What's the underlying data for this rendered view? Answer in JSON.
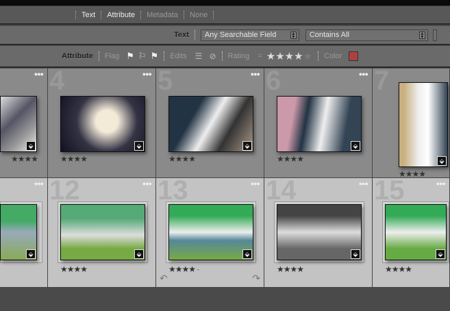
{
  "tabs": [
    "Text",
    "Attribute",
    "Metadata",
    "None"
  ],
  "text_filter": {
    "label": "Text",
    "field": "Any Searchable Field",
    "rule": "Contains All"
  },
  "attribute_filter": {
    "label": "Attribute",
    "flag_label": "Flag",
    "edits_label": "Edits",
    "rating_label": "Rating",
    "rating_op": "=",
    "rating_value": 4,
    "color_label": "Color",
    "color_swatch": "#b04040"
  },
  "cells": [
    {
      "num": "",
      "stars": "★★★★"
    },
    {
      "num": "4",
      "stars": "★★★★"
    },
    {
      "num": "5",
      "stars": "★★★★"
    },
    {
      "num": "6",
      "stars": "★★★★"
    },
    {
      "num": "7",
      "stars": "★★★★"
    },
    {
      "num": "",
      "stars": ""
    },
    {
      "num": "12",
      "stars": "★★★★"
    },
    {
      "num": "13",
      "stars": "★★★★ ·"
    },
    {
      "num": "14",
      "stars": "★★★★"
    },
    {
      "num": "15",
      "stars": "★★★★"
    }
  ]
}
